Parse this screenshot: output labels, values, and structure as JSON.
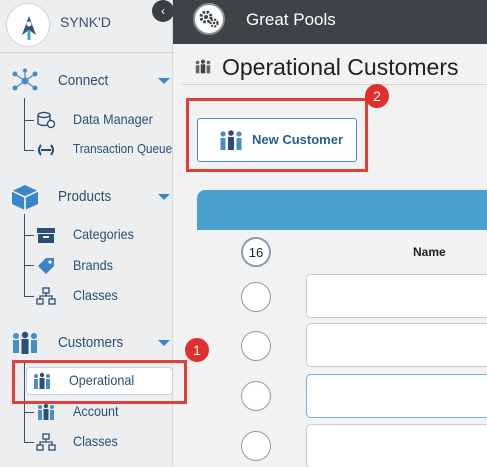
{
  "brand": {
    "name": "SYNK'D",
    "collapse_glyph": "‹"
  },
  "header": {
    "title": "Great Pools",
    "icon": "gears-icon"
  },
  "page": {
    "title": "Operational Customers",
    "icon": "customers-icon"
  },
  "toolbar": {
    "new_customer_label": "New Customer"
  },
  "sidebar": {
    "sections": [
      {
        "label": "Connect",
        "icon": "network-icon",
        "items": [
          {
            "label": "Data Manager",
            "icon": "database-gear-icon"
          },
          {
            "label": "Transaction Queue",
            "icon": "sync-queue-icon"
          }
        ]
      },
      {
        "label": "Products",
        "icon": "box-icon",
        "items": [
          {
            "label": "Categories",
            "icon": "archive-icon"
          },
          {
            "label": "Brands",
            "icon": "tag-icon"
          },
          {
            "label": "Classes",
            "icon": "hierarchy-icon"
          }
        ]
      },
      {
        "label": "Customers",
        "icon": "customers-icon",
        "items": [
          {
            "label": "Operational",
            "icon": "customers-icon",
            "active": true
          },
          {
            "label": "Account",
            "icon": "customers-icon"
          },
          {
            "label": "Classes",
            "icon": "hierarchy-icon"
          }
        ]
      }
    ]
  },
  "table": {
    "count": "16",
    "columns": [
      "Name"
    ]
  },
  "annotations": [
    {
      "number": "1"
    },
    {
      "number": "2"
    }
  ],
  "colors": {
    "header_bg": "#3e4347",
    "accent": "#4aa3cf",
    "highlight": "#e0403a",
    "text": "#2c4f75"
  }
}
